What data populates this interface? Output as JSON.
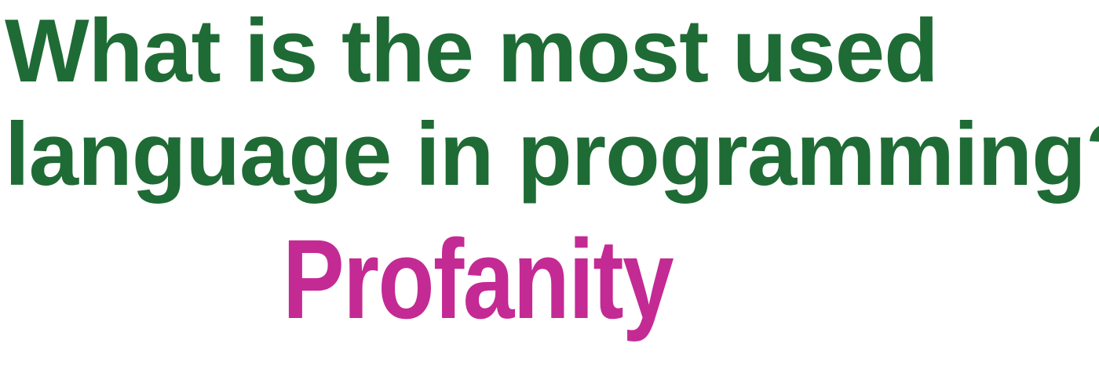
{
  "question": {
    "line1": "What is the most used",
    "line2": "language in programming?"
  },
  "answer": {
    "text": "Profanity"
  },
  "colors": {
    "question": "#1f6b35",
    "answer": "#c42a94",
    "background": "#ffffff"
  }
}
